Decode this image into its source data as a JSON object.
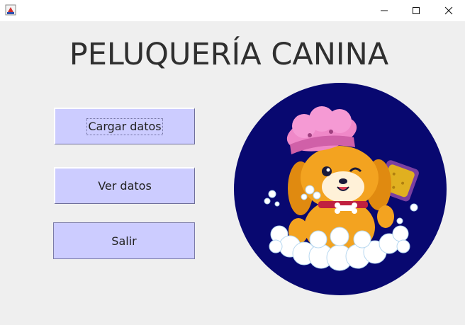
{
  "window": {
    "icon": "java-app-icon",
    "controls": [
      "minimize-icon",
      "maximize-icon",
      "close-icon"
    ]
  },
  "main": {
    "title": "PELUQUERÍA CANINA",
    "buttons": {
      "load": "Cargar datos",
      "view": "Ver datos",
      "exit": "Salir"
    },
    "image": "dog-bath-logo"
  },
  "colors": {
    "button_bg": "#ccccff",
    "logo_circle": "#080870",
    "background": "#efefef"
  }
}
